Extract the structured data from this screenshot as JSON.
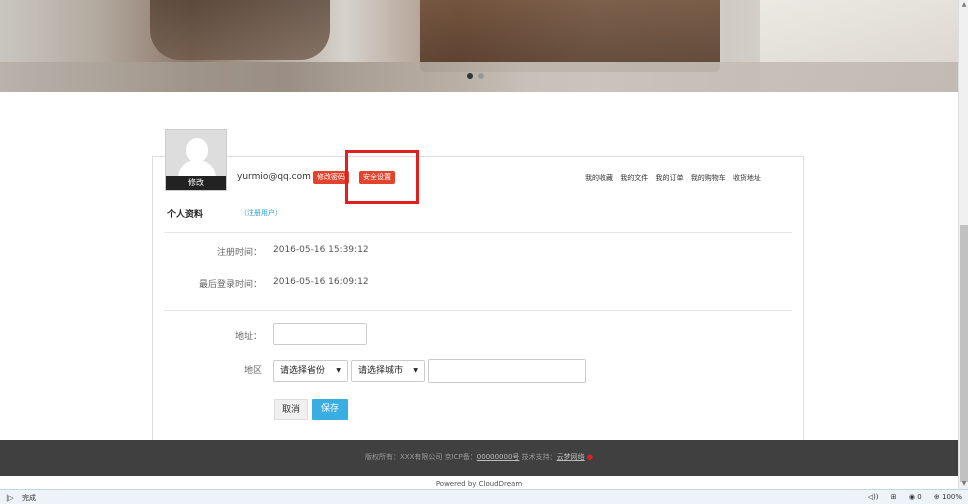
{
  "banner": {
    "active_slide": 1,
    "slide_count": 2
  },
  "profile": {
    "avatar_edit_label": "修改",
    "email": "yurmio@qq.com",
    "change_password_label": "修改密码",
    "security_settings_label": "安全设置",
    "top_links": [
      "我的收藏",
      "我的文件",
      "我的订单",
      "我的购物车",
      "收货地址"
    ],
    "section_title": "个人资料",
    "user_type": "（注册用户）",
    "register_time_label": "注册时间：",
    "register_time_value": "2016-05-16 15:39:12",
    "last_login_label": "最后登录时间：",
    "last_login_value": "2016-05-16 16:09:12"
  },
  "form": {
    "address_label": "地址：",
    "address_value": "",
    "region_label": "地区",
    "province_selected": "请选择省份",
    "city_selected": "请选择城市",
    "detail_value": "",
    "cancel_label": "取消",
    "save_label": "保存"
  },
  "footer": {
    "copyright": "版权所有：XXX有限公司  京ICP备：",
    "icp_number": "00000000号",
    "support_prefix": "   技术支持：",
    "support_link": "云梦网络",
    "powered_by": "Powered by CloudDream"
  },
  "statusbar": {
    "status_text": "完成",
    "zoom": "100%",
    "blocked_count": "0"
  },
  "colors": {
    "accent_red": "#e2432d",
    "accent_blue": "#3aaee0",
    "highlight": "#e02020",
    "footer_bg": "#404040"
  }
}
